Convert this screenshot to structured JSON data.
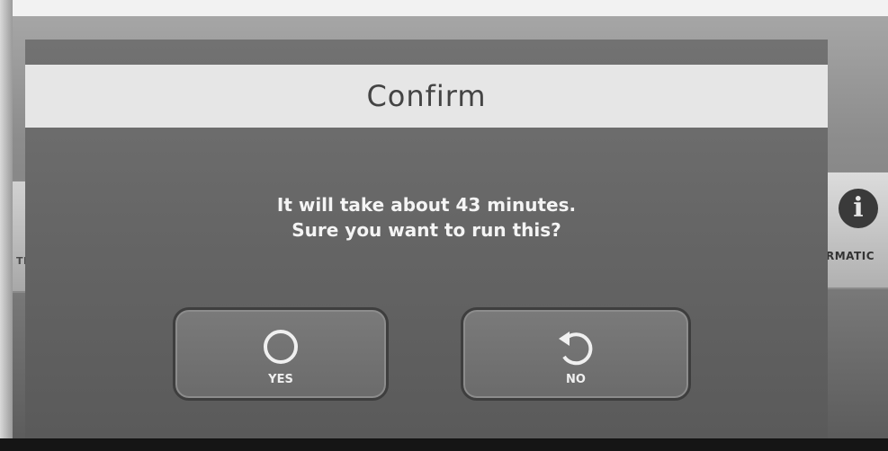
{
  "dialog": {
    "title": "Confirm",
    "message_line1": "It will take about 43 minutes.",
    "message_line2": "Sure you want to run this?",
    "yes_label": "YES",
    "yes_icon": "circle-icon",
    "no_label": "NO",
    "no_icon": "undo-arrow-icon"
  },
  "background": {
    "left_tile_label": "TH C",
    "right_tile_label": "RMATIC",
    "right_tile_icon": "info-icon"
  }
}
